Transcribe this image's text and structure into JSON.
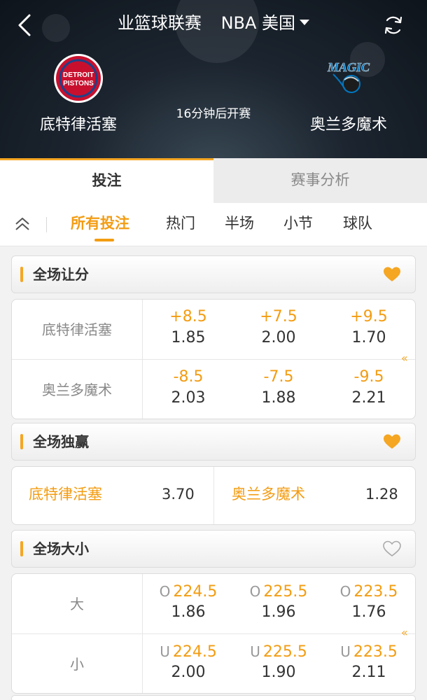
{
  "header": {
    "back_icon": "chevron-left-icon",
    "league": "业篮球联赛",
    "region": "NBA 美国",
    "refresh_icon": "refresh-icon",
    "home_team": {
      "name": "底特律活塞",
      "logo_text_1": "DETROIT",
      "logo_text_2": "PISTONS"
    },
    "away_team": {
      "name": "奥兰多魔术",
      "logo_text": "MAGIC"
    },
    "kickoff": "16分钟后开赛"
  },
  "tabs": [
    {
      "label": "投注",
      "active": true
    },
    {
      "label": "赛事分析",
      "active": false
    }
  ],
  "sub_tabs": [
    {
      "label": "所有投注",
      "active": true
    },
    {
      "label": "热门",
      "active": false
    },
    {
      "label": "半场",
      "active": false
    },
    {
      "label": "小节",
      "active": false
    },
    {
      "label": "球队",
      "active": false
    }
  ],
  "sections": {
    "handicap": {
      "title": "全场让分",
      "favorited": true,
      "rows": [
        {
          "label": "底特律活塞",
          "cells": [
            {
              "line": "+8.5",
              "odds": "1.85"
            },
            {
              "line": "+7.5",
              "odds": "2.00"
            },
            {
              "line": "+9.5",
              "odds": "1.70"
            }
          ]
        },
        {
          "label": "奥兰多魔术",
          "cells": [
            {
              "line": "-8.5",
              "odds": "2.03"
            },
            {
              "line": "-7.5",
              "odds": "1.88"
            },
            {
              "line": "-9.5",
              "odds": "2.21"
            }
          ]
        }
      ]
    },
    "moneyline": {
      "title": "全场独赢",
      "favorited": true,
      "options": [
        {
          "team": "底特律活塞",
          "odds": "3.70"
        },
        {
          "team": "奥兰多魔术",
          "odds": "1.28"
        }
      ]
    },
    "totals": {
      "title": "全场大小",
      "favorited": false,
      "rows": [
        {
          "label": "大",
          "prefix": "O",
          "cells": [
            {
              "line": "224.5",
              "odds": "1.86"
            },
            {
              "line": "225.5",
              "odds": "1.96"
            },
            {
              "line": "223.5",
              "odds": "1.76"
            }
          ]
        },
        {
          "label": "小",
          "prefix": "U",
          "cells": [
            {
              "line": "224.5",
              "odds": "2.00"
            },
            {
              "line": "225.5",
              "odds": "1.90"
            },
            {
              "line": "223.5",
              "odds": "2.11"
            }
          ]
        }
      ]
    }
  },
  "more_arrow": "«",
  "colors": {
    "accent": "#f39c12",
    "heart_active": "#f5a623",
    "heart_inactive": "#aaaaaa"
  }
}
